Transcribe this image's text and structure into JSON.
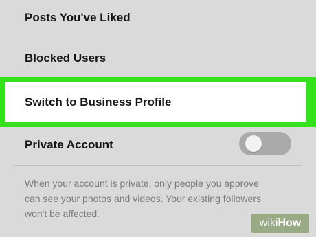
{
  "settings": {
    "items": [
      {
        "label": "Posts You've Liked"
      },
      {
        "label": "Blocked Users"
      },
      {
        "label": "Switch to Business Profile"
      },
      {
        "label": "Private Account"
      }
    ],
    "private_account": {
      "enabled": false,
      "description_lines": [
        "When your account is private, only people you approve",
        "can see your photos and videos. Your existing followers",
        "won't be affected."
      ]
    }
  },
  "highlight": {
    "color": "#34e21c"
  },
  "watermark": {
    "part1": "wiki",
    "part2": "How"
  }
}
